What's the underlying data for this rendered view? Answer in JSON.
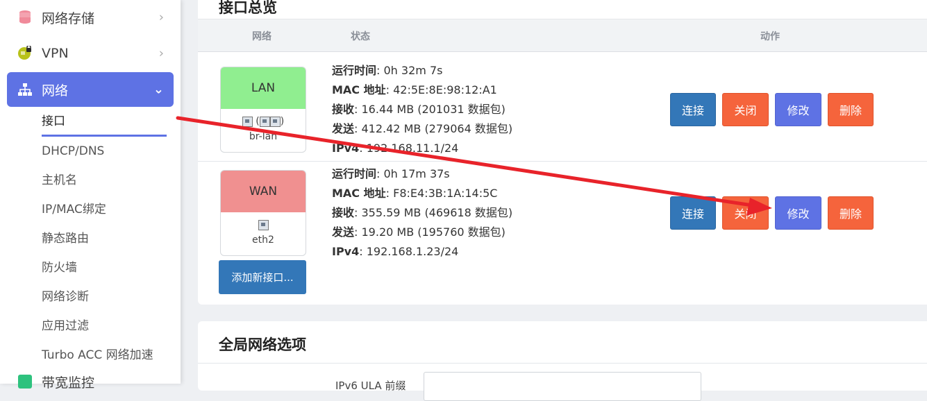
{
  "sidebar": {
    "items": [
      {
        "label": "网络存储",
        "icon": "database-icon"
      },
      {
        "label": "VPN",
        "icon": "vpn-icon"
      },
      {
        "label": "网络",
        "icon": "network-icon"
      }
    ],
    "subitems": [
      "接口",
      "DHCP/DNS",
      "主机名",
      "IP/MAC绑定",
      "静态路由",
      "防火墙",
      "网络诊断",
      "应用过滤",
      "Turbo ACC 网络加速"
    ],
    "next_item_label": "带宽监控"
  },
  "overview": {
    "title": "接口总览",
    "headers": {
      "network": "网络",
      "status": "状态",
      "actions": "动作"
    },
    "interfaces": [
      {
        "name": "LAN",
        "color": "#90ee90",
        "device": "br-lan",
        "icons": "(  )",
        "uptime_label": "运行时间",
        "uptime": "0h 32m 7s",
        "mac_label": "MAC 地址",
        "mac": "42:5E:8E:98:12:A1",
        "rx_label": "接收",
        "rx": "16.44 MB (201031 数据包)",
        "tx_label": "发送",
        "tx": "412.42 MB (279064 数据包)",
        "ipv4_label": "IPv4",
        "ipv4": "192.168.11.1/24"
      },
      {
        "name": "WAN",
        "color": "#f09090",
        "device": "eth2",
        "icons": "",
        "uptime_label": "运行时间",
        "uptime": "0h 17m 37s",
        "mac_label": "MAC 地址",
        "mac": "F8:E4:3B:1A:14:5C",
        "rx_label": "接收",
        "rx": "355.59 MB (469618 数据包)",
        "tx_label": "发送",
        "tx": "19.20 MB (195760 数据包)",
        "ipv4_label": "IPv4",
        "ipv4": "192.168.1.23/24"
      }
    ],
    "buttons": {
      "connect": "连接",
      "stop": "关闭",
      "edit": "修改",
      "delete": "删除"
    },
    "add_button": "添加新接口..."
  },
  "global": {
    "title": "全局网络选项",
    "field_label": "IPv6 ULA 前缀"
  },
  "colors": {
    "accent": "#5e72e4",
    "blue": "#3377b8",
    "red": "#f5643c",
    "arrow": "#e8232a"
  }
}
